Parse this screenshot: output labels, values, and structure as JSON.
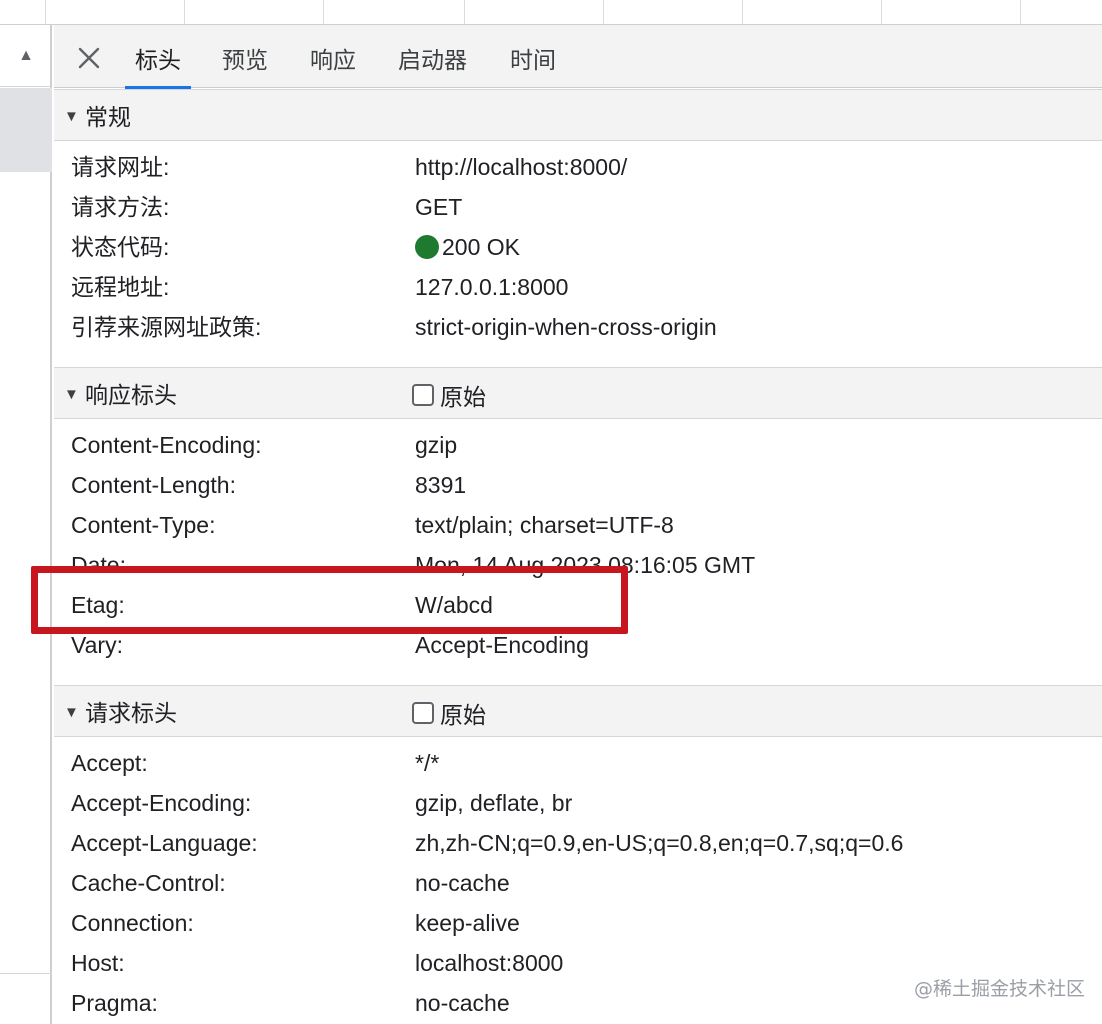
{
  "tabs": [
    {
      "label": "标头",
      "active": true
    },
    {
      "label": "预览",
      "active": false
    },
    {
      "label": "响应",
      "active": false
    },
    {
      "label": "启动器",
      "active": false
    },
    {
      "label": "时间",
      "active": false
    }
  ],
  "icons": {
    "close": "close-icon",
    "scroll_up": "triangle-up-icon",
    "collapse": "triangle-down-icon"
  },
  "general": {
    "title": "常规",
    "rows": [
      {
        "key": "请求网址:",
        "value": "http://localhost:8000/"
      },
      {
        "key": "请求方法:",
        "value": "GET"
      },
      {
        "key": "状态代码:",
        "value": "200 OK"
      },
      {
        "key": "远程地址:",
        "value": "127.0.0.1:8000"
      },
      {
        "key": "引荐来源网址政策:",
        "value": "strict-origin-when-cross-origin"
      }
    ]
  },
  "response_headers": {
    "title": "响应标头",
    "raw_label": "原始",
    "rows": [
      {
        "key": "Content-Encoding:",
        "value": "gzip"
      },
      {
        "key": "Content-Length:",
        "value": "8391"
      },
      {
        "key": "Content-Type:",
        "value": "text/plain; charset=UTF-8"
      },
      {
        "key": "Date:",
        "value": "Mon, 14 Aug 2023 08:16:05 GMT"
      },
      {
        "key": "Etag:",
        "value": "W/abcd"
      },
      {
        "key": "Vary:",
        "value": "Accept-Encoding"
      }
    ]
  },
  "request_headers": {
    "title": "请求标头",
    "raw_label": "原始",
    "rows": [
      {
        "key": "Accept:",
        "value": "*/*"
      },
      {
        "key": "Accept-Encoding:",
        "value": "gzip, deflate, br"
      },
      {
        "key": "Accept-Language:",
        "value": "zh,zh-CN;q=0.9,en-US;q=0.8,en;q=0.7,sq;q=0.6"
      },
      {
        "key": "Cache-Control:",
        "value": "no-cache"
      },
      {
        "key": "Connection:",
        "value": "keep-alive"
      },
      {
        "key": "Host:",
        "value": "localhost:8000"
      },
      {
        "key": "Pragma:",
        "value": "no-cache"
      }
    ]
  },
  "colors": {
    "status_ok": "#1e7a2e",
    "tab_underline": "#1a73e8",
    "highlight_border": "#c8161e"
  },
  "watermark": "@稀土掘金技术社区"
}
